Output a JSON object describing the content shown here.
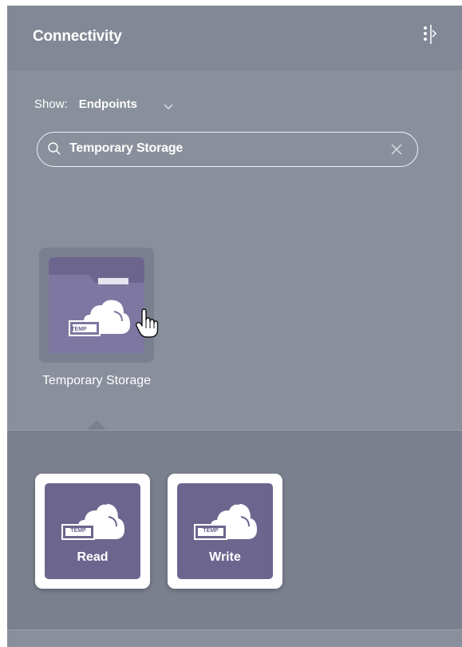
{
  "panel": {
    "title": "Connectivity",
    "collapse_icon": "collapse-panel-icon"
  },
  "filter": {
    "show_label": "Show:",
    "show_value": "Endpoints",
    "chevron_icon": "chevron-down-icon"
  },
  "search": {
    "value": "Temporary Storage",
    "placeholder": "",
    "search_icon": "search-icon",
    "clear_icon": "close-icon"
  },
  "endpoint": {
    "label": "Temporary Storage",
    "icon": "temp-storage-folder-icon",
    "badge": "TEMP"
  },
  "actions": [
    {
      "label": "Read",
      "icon": "temp-cloud-icon",
      "badge": "TEMP"
    },
    {
      "label": "Write",
      "icon": "temp-cloud-icon",
      "badge": "TEMP"
    }
  ],
  "colors": {
    "panel_bg": "#8a8f9c",
    "header_bg": "#838896",
    "tile_purple": "#6c668f",
    "actions_bg": "#7b808e"
  }
}
